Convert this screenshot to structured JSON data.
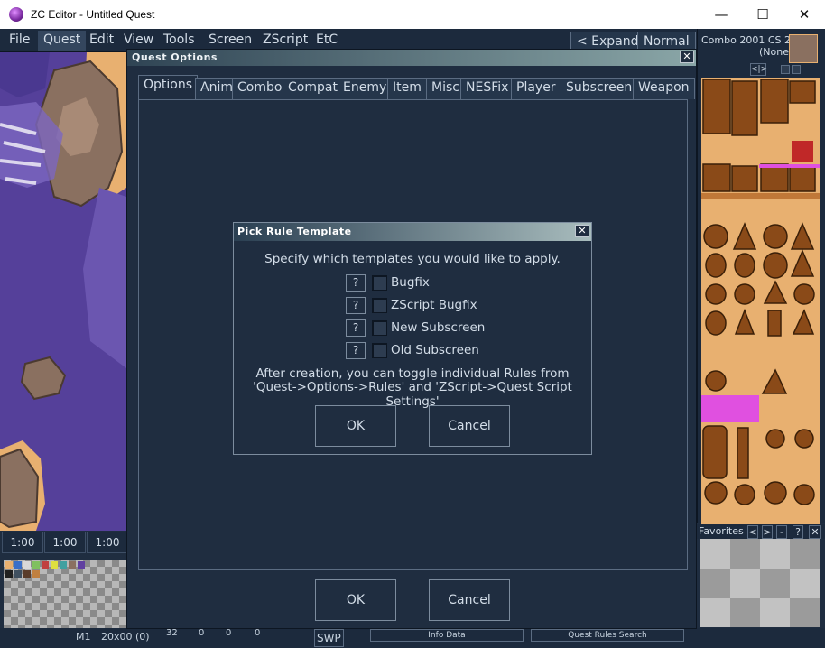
{
  "window": {
    "title": "ZC Editor - Untitled Quest",
    "minimize": "—",
    "maximize": "☐",
    "close": "✕"
  },
  "menubar": {
    "items": [
      "File",
      "Quest",
      "Edit",
      "View",
      "Tools",
      "Screen",
      "ZScript",
      "EtC"
    ],
    "expand": "< Expand",
    "mode": "Normal"
  },
  "map": {
    "zoom": [
      "1:00",
      "1:00",
      "1:00"
    ]
  },
  "combo_panel": {
    "info_line1": "Combo  2001  CS  2",
    "info_line2": "(None)",
    "nav": "<|>"
  },
  "favorites": {
    "label": "Favorites",
    "buttons": [
      "<",
      ">",
      "-",
      "?",
      "✕"
    ]
  },
  "status": {
    "m": "M1",
    "coords": "20x00  (0)",
    "n1": "32",
    "n2": "0",
    "n3": "0",
    "n4": "0",
    "swp": "SWP",
    "info_data": "Info Data",
    "rules_search": "Quest Rules Search"
  },
  "quest_options": {
    "title": "Quest  Options",
    "tabs": [
      "Options",
      "Anim",
      "Combo",
      "Compat",
      "Enemy",
      "Item",
      "Misc",
      "NESFix",
      "Player",
      "Subscreen",
      "Weapon"
    ],
    "ok": "OK",
    "cancel": "Cancel"
  },
  "rule_template": {
    "title": "Pick  Rule  Template",
    "prompt": "Specify which templates you would like to apply.",
    "options": [
      {
        "help": "?",
        "label": "Bugfix"
      },
      {
        "help": "?",
        "label": "ZScript Bugfix"
      },
      {
        "help": "?",
        "label": "New Subscreen"
      },
      {
        "help": "?",
        "label": "Old Subscreen"
      }
    ],
    "note_line1": "After creation, you can toggle individual Rules from",
    "note_line2": "'Quest->Options->Rules' and 'ZScript->Quest Script Settings'",
    "ok": "OK",
    "cancel": "Cancel"
  },
  "colors": {
    "bg": "#1f2d40",
    "water": "#55409a",
    "sand": "#e8b070",
    "rock": "#8a7060"
  }
}
